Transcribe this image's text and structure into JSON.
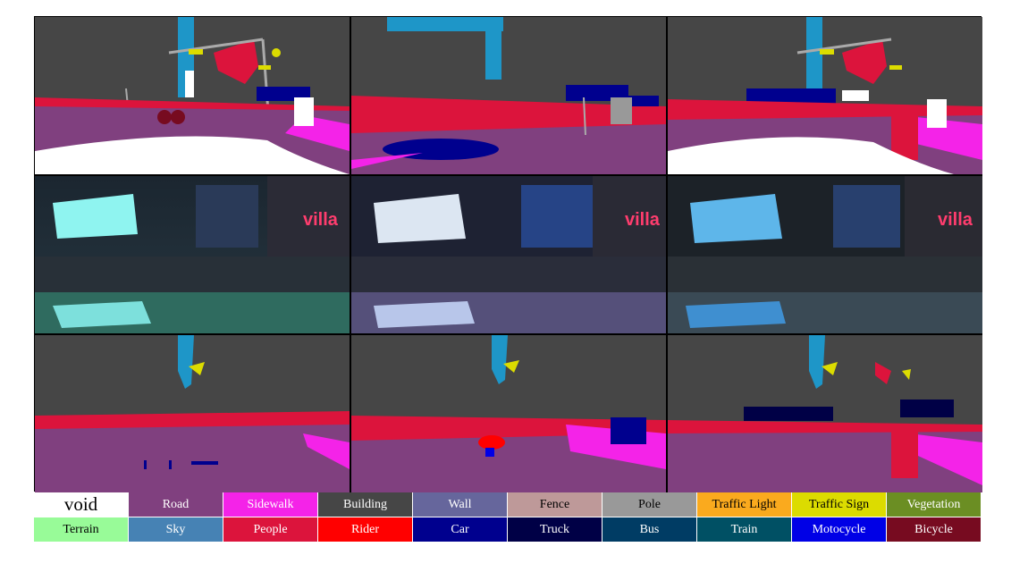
{
  "legend": {
    "row1": [
      {
        "label": "void",
        "color": "#ffffff"
      },
      {
        "label": "Road",
        "color": "#80407f"
      },
      {
        "label": "Sidewalk",
        "color": "#f423e8"
      },
      {
        "label": "Building",
        "color": "#464646"
      },
      {
        "label": "Wall",
        "color": "#66669c"
      },
      {
        "label": "Fence",
        "color": "#be9999"
      },
      {
        "label": "Pole",
        "color": "#999999"
      },
      {
        "label": "Traffic Light",
        "color": "#faaa1e"
      },
      {
        "label": "Traffic Sign",
        "color": "#dcdc00"
      },
      {
        "label": "Vegetation",
        "color": "#6b8e23"
      }
    ],
    "row2": [
      {
        "label": "Terrain",
        "color": "#98fb98"
      },
      {
        "label": "Sky",
        "color": "#4682b4"
      },
      {
        "label": "People",
        "color": "#dc143c"
      },
      {
        "label": "Rider",
        "color": "#ff0000"
      },
      {
        "label": "Car",
        "color": "#00008e"
      },
      {
        "label": "Truck",
        "color": "#000046"
      },
      {
        "label": "Bus",
        "color": "#003c64"
      },
      {
        "label": "Train",
        "color": "#005064"
      },
      {
        "label": "Motocycle",
        "color": "#0000e6"
      },
      {
        "label": "Bicycle",
        "color": "#770b20"
      }
    ]
  },
  "photo_signs": [
    "villa",
    "villa",
    "villa"
  ]
}
